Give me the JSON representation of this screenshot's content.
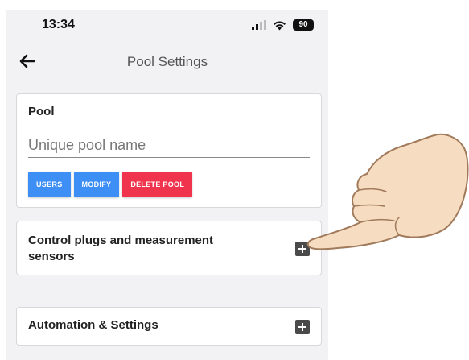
{
  "status_bar": {
    "time": "13:34",
    "battery": "90"
  },
  "header": {
    "title": "Pool Settings"
  },
  "pool_card": {
    "heading": "Pool",
    "name_placeholder": "Unique pool name",
    "buttons": {
      "users": "USERS",
      "modify": "MODIFY",
      "delete": "DELETE POOL"
    }
  },
  "plugs_card": {
    "heading": "Control plugs and measurement sensors"
  },
  "automation_card": {
    "heading": "Automation & Settings"
  },
  "colors": {
    "primary_button": "#3d8ef5",
    "danger_button": "#f0344d",
    "background": "#f2f2f4"
  },
  "icons": [
    "back-arrow-icon",
    "signal-icon",
    "wifi-icon",
    "battery-icon",
    "plus-box-icon",
    "pointing-hand-icon"
  ]
}
